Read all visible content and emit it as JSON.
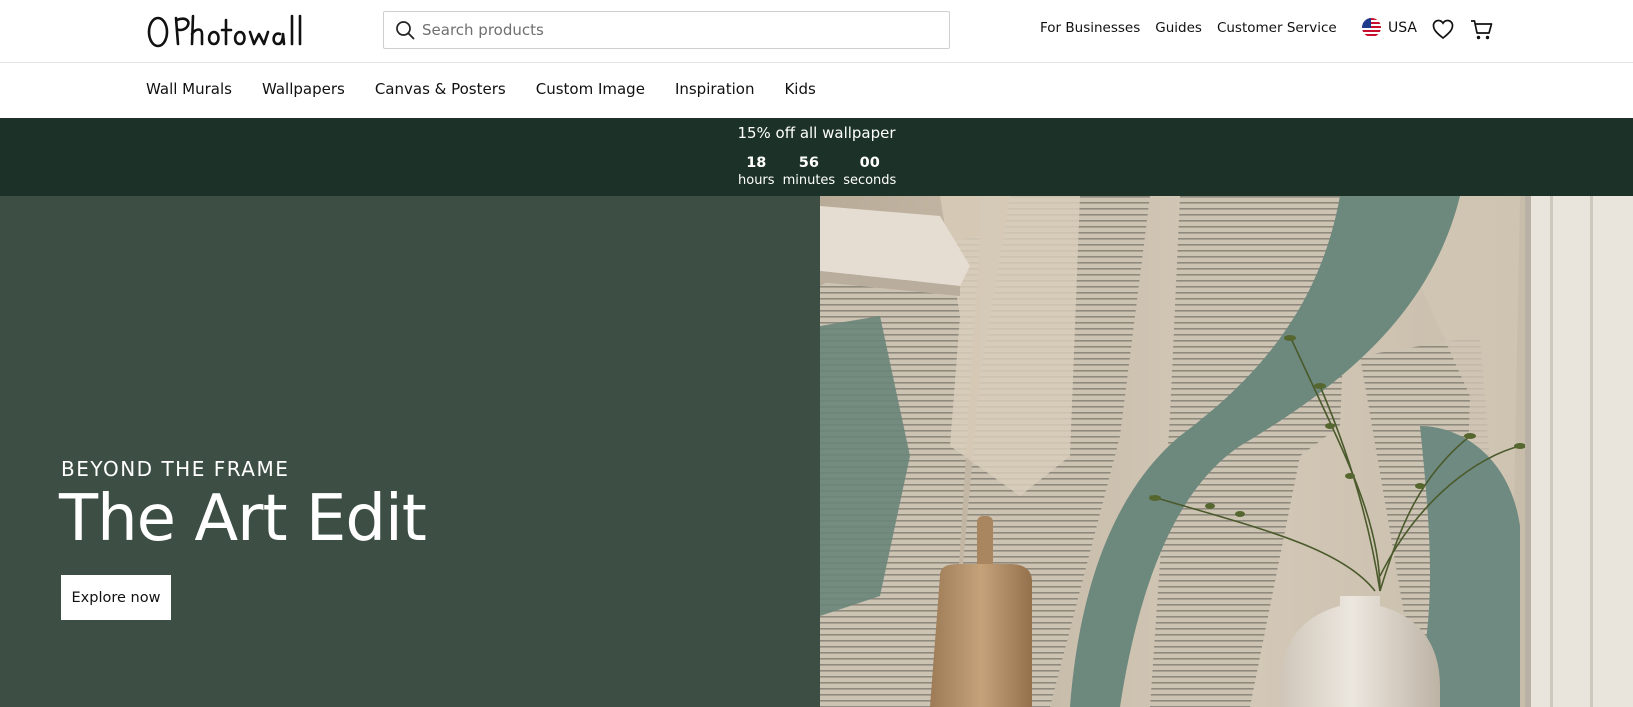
{
  "header": {
    "logo_text": "Photowall",
    "search_placeholder": "Search products",
    "links": [
      "For Businesses",
      "Guides",
      "Customer Service"
    ],
    "locale": "USA"
  },
  "nav": {
    "items": [
      "Wall Murals",
      "Wallpapers",
      "Canvas & Posters",
      "Custom Image",
      "Inspiration",
      "Kids"
    ]
  },
  "promo": {
    "title": "15% off all wallpaper",
    "countdown": [
      {
        "value": "18",
        "label": "hours"
      },
      {
        "value": "56",
        "label": "minutes"
      },
      {
        "value": "00",
        "label": "seconds"
      }
    ]
  },
  "hero": {
    "eyebrow": "BEYOND THE FRAME",
    "headline": "The Art Edit",
    "cta": "Explore now"
  },
  "colors": {
    "promo_bg": "#1c3127",
    "hero_bg": "#3d4e45",
    "mural_beige": "#cbbfae",
    "mural_green": "#6f8a80"
  },
  "icons": [
    "search-icon",
    "us-flag-icon",
    "heart-icon",
    "cart-icon"
  ]
}
